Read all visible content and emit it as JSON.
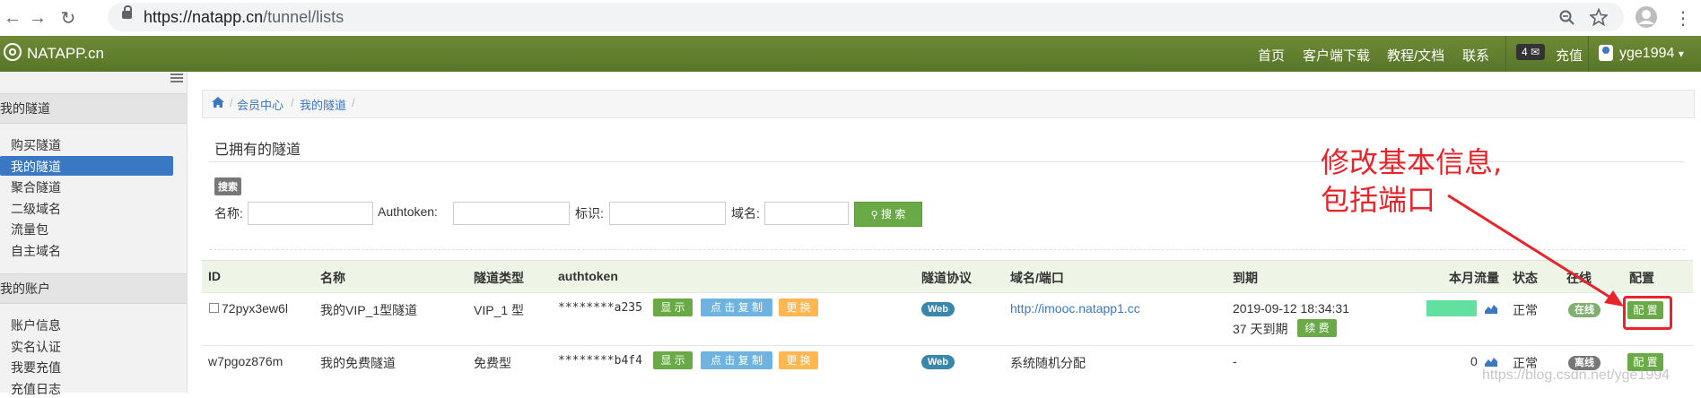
{
  "browser": {
    "url_host": "https://natapp.cn",
    "url_path": "/tunnel/lists"
  },
  "header": {
    "brand": "NATAPP.cn",
    "nav": [
      "首页",
      "客户端下载",
      "教程/文档",
      "联系"
    ],
    "badge_count": "4",
    "recharge": "充值",
    "username": "yge1994",
    "caret": "▾"
  },
  "sidebar": {
    "section1": "我的隧道",
    "items1": [
      "购买隧道",
      "我的隧道",
      "聚合隧道",
      "二级域名",
      "流量包",
      "自主域名"
    ],
    "section2": "我的账户",
    "items2": [
      "账户信息",
      "实名认证",
      "我要充值",
      "充值日志"
    ]
  },
  "breadcrumb": [
    "会员中心",
    "我的隧道"
  ],
  "page_title": "已拥有的隧道",
  "search": {
    "tag": "搜索",
    "name_label": "名称:",
    "authtoken_label": "Authtoken:",
    "tag_label": "标识:",
    "domain_label": "域名:",
    "button": "搜 索"
  },
  "table": {
    "headers": [
      "ID",
      "名称",
      "隧道类型",
      "authtoken",
      "隧道协议",
      "域名/端口",
      "到期",
      "本月流量",
      "状态",
      "在线",
      "配置"
    ],
    "rows": [
      {
        "id": "72pyx3ew6l",
        "name": "我的VIP_1型隧道",
        "type": "VIP_1 型",
        "token": "********a235",
        "show": "显 示",
        "copy": "点 击 复 制",
        "change": "更 换",
        "protocol": "Web",
        "domain": "http://imooc.natapp1.cc",
        "expire": "2019-09-12 18:34:31",
        "expire_days": "37 天到期",
        "renew": "续 费",
        "traffic": "",
        "status": "正常",
        "online": "在线",
        "config": "配 置"
      },
      {
        "id": "w7pgoz876m",
        "name": "我的免费隧道",
        "type": "免费型",
        "token": "********b4f4",
        "show": "显 示",
        "copy": "点 击 复 制",
        "change": "更 换",
        "protocol": "Web",
        "domain": "系统随机分配",
        "expire": "-",
        "traffic": "0",
        "status": "正常",
        "online": "离线",
        "config": "配 置"
      }
    ]
  },
  "annotation": {
    "line1": "修改基本信息,",
    "line2": "包括端口"
  },
  "watermark": "https://blog.csdn.net/yge1994"
}
